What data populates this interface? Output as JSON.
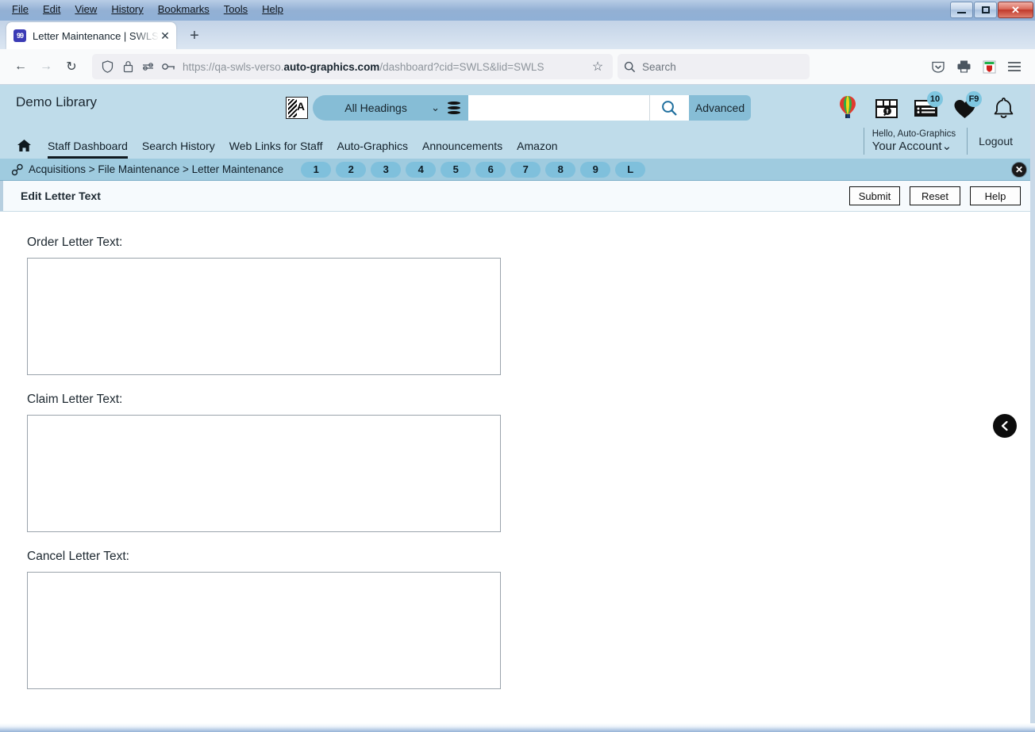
{
  "browser": {
    "menus": [
      "File",
      "Edit",
      "View",
      "History",
      "Bookmarks",
      "Tools",
      "Help"
    ],
    "window_controls": {
      "minimize": "minimize-button",
      "maximize": "maximize-button",
      "close": "✕"
    },
    "tab": {
      "favicon_text": "99",
      "title": "Letter Maintenance | SWLS | ",
      "title_dim": "swl",
      "close_label": "✕"
    },
    "new_tab_label": "+",
    "nav": {
      "back": "←",
      "forward": "→",
      "reload": "↻"
    },
    "url": {
      "prefix": "https://qa-swls-verso.",
      "domain": "auto-graphics.com",
      "suffix": "/dashboard?cid=SWLS&lid=SWLS",
      "star_label": "☆"
    },
    "search": {
      "placeholder": "Search"
    },
    "toolbar_icons": [
      "pocket-icon",
      "print-icon",
      "extension-icon",
      "hamburger-menu-icon"
    ]
  },
  "app": {
    "library_name": "Demo Library",
    "search": {
      "flag_letter": "A",
      "scope_label": "All Headings",
      "caret": "⌄",
      "input_value": "",
      "input_placeholder": "",
      "advanced_label": "Advanced"
    },
    "header_icons": [
      {
        "name": "balloon-icon",
        "badge": ""
      },
      {
        "name": "map-search-icon",
        "badge": ""
      },
      {
        "name": "list-icon",
        "badge": "10"
      },
      {
        "name": "heart-icon",
        "badge": "F9"
      },
      {
        "name": "bell-icon",
        "badge": ""
      }
    ],
    "account": {
      "greeting": "Hello, Auto-Graphics",
      "link": "Your Account",
      "caret": "⌄",
      "logout": "Logout"
    },
    "nav_links": [
      {
        "label": "Staff Dashboard",
        "active": true
      },
      {
        "label": "Search History",
        "active": false
      },
      {
        "label": "Web Links for Staff",
        "active": false
      },
      {
        "label": "Auto-Graphics",
        "active": false
      },
      {
        "label": "Announcements",
        "active": false
      },
      {
        "label": "Amazon",
        "active": false
      }
    ],
    "breadcrumb": {
      "text": "Acquisitions > File Maintenance > Letter Maintenance",
      "pills": [
        "1",
        "2",
        "3",
        "4",
        "5",
        "6",
        "7",
        "8",
        "9",
        "L"
      ],
      "close_label": "✕"
    },
    "page": {
      "title": "Edit Letter Text",
      "buttons": [
        {
          "label": "Submit",
          "name": "submit-button"
        },
        {
          "label": "Reset",
          "name": "reset-button"
        },
        {
          "label": "Help",
          "name": "help-button"
        }
      ]
    },
    "form": {
      "fields": [
        {
          "label": "Order Letter Text:",
          "value": "",
          "name": "order-letter-text"
        },
        {
          "label": "Claim Letter Text:",
          "value": "",
          "name": "claim-letter-text"
        },
        {
          "label": "Cancel Letter Text:",
          "value": "",
          "name": "cancel-letter-text"
        }
      ]
    },
    "back_button": "‹"
  },
  "colors": {
    "header_bg": "#bfdcea",
    "crumb_bg": "#9fcbdf",
    "pill_bg": "#7fc0dc",
    "accent": "#86bdd6"
  }
}
